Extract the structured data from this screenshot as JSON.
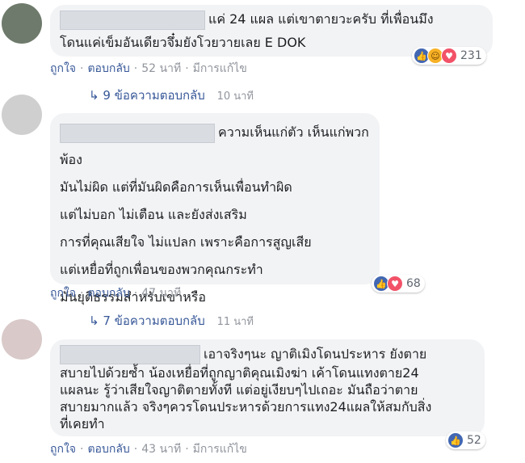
{
  "comments": [
    {
      "text_lines": [
        "แค่ 24 แผล แต่เขาตายวะครับ ที่เพื่อนมึง",
        "โดนแค่เข็มอันเดียวจึ๋มยังโวยวายเลย E DOK"
      ],
      "actions": {
        "like": "ถูกใจ",
        "reply": "ตอบกลับ",
        "time": "52 นาที",
        "edited": "มีการแก้ไข"
      },
      "reaction_count": "231",
      "reactions": [
        "like-icon",
        "haha-icon",
        "love-icon"
      ],
      "replies": {
        "label": "9 ข้อความตอบกลับ",
        "time": "10 นาที"
      }
    },
    {
      "text_lines": [
        "ความเห็นแก่ตัว เห็นแก่พวกพ้อง",
        "มันไม่ผิด แต่ที่มันผิดคือการเห็นเพื่อนทำผิด",
        "แต่ไม่บอก ไม่เตือน และยังส่งเสริม",
        "การที่คุณเสียใจ ไม่แปลก เพราะคือการสูญเสีย",
        "แต่เหยื่อที่ถูกเพื่อนของพวกคุณกระทำ",
        "มันยุติธรรมสำหรับเขาหรือ"
      ],
      "actions": {
        "like": "ถูกใจ",
        "reply": "ตอบกลับ",
        "time": "47 นาที"
      },
      "reaction_count": "68",
      "reactions": [
        "like-icon",
        "love-icon"
      ],
      "replies": {
        "label": "7 ข้อความตอบกลับ",
        "time": "11 นาที"
      }
    },
    {
      "text_lines": [
        "เอาจริงๆนะ ญาติเมิงโดนประหาร ยังตาย",
        "สบายไปด้วยซ้ำ น้องเหยื่อที่ถูกญาติคุณเมิงฆ่า เค้าโดนแทงตาย24",
        "แผลนะ รู้ว่าเสียใจญาติตายทั้งที แต่อยู่เงียบๆไปเถอะ มันถือว่าตาย",
        "สบายมากแล้ว จริงๆควรโดนประหารด้วยการแทง24แผลให้สมกับสิ่ง",
        "ที่เคยทำ"
      ],
      "actions": {
        "like": "ถูกใจ",
        "reply": "ตอบกลับ",
        "time": "43 นาที",
        "edited": "มีการแก้ไข"
      },
      "reaction_count": "52",
      "reactions": [
        "like-icon"
      ]
    }
  ],
  "colors": {
    "link": "#385898",
    "bubble": "#f2f3f5",
    "meta": "#90949c"
  }
}
